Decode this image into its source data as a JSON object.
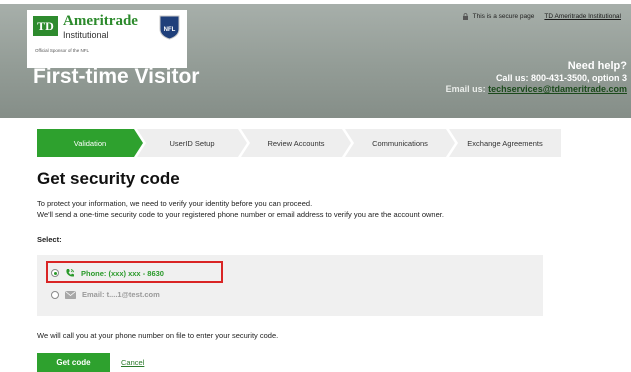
{
  "header": {
    "brand_logo_text": "TD",
    "brand_name": "Ameritrade",
    "brand_sub": "Institutional",
    "sponsor_text": "Official Sponsor of the NFL",
    "nfl_shield_text": "NFL",
    "secure_text": "This is a secure page",
    "institutional_link": "TD Ameritrade Institutional",
    "page_title": "First-time Visitor",
    "help_title": "Need help?",
    "help_phone": "Call us: 800-431-3500, option 3",
    "help_email_label": "Email us:",
    "help_email": "techservices@tdameritrade.com"
  },
  "steps": [
    {
      "label": "Validation",
      "active": true
    },
    {
      "label": "UserID Setup",
      "active": false
    },
    {
      "label": "Review Accounts",
      "active": false
    },
    {
      "label": "Communications",
      "active": false
    },
    {
      "label": "Exchange Agreements",
      "active": false
    }
  ],
  "main": {
    "title": "Get security code",
    "intro_line1": "To protect your information, we need to verify your identity before you can proceed.",
    "intro_line2": "We'll send a one-time security code to your registered phone number or email address to verify you are the account owner.",
    "select_label": "Select:",
    "phone_option": "Phone: (xxx) xxx - 8630",
    "email_option": "Email: t....1@test.com",
    "call_note": "We will call you at your phone number on file to enter your security code.",
    "get_code_button": "Get code",
    "cancel_link": "Cancel"
  },
  "colors": {
    "brand_green": "#2ea12e",
    "highlight_red": "#d92525",
    "banner_gray": "#939c96"
  },
  "icons": [
    "lock-icon",
    "nfl-shield-icon",
    "phone-icon",
    "envelope-icon"
  ]
}
